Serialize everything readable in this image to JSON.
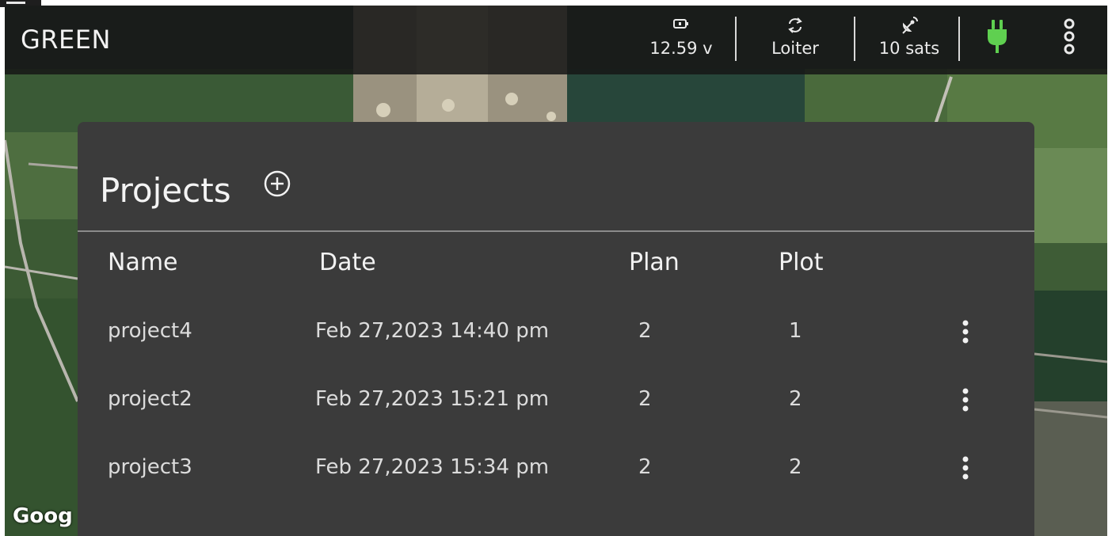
{
  "topbar": {
    "vehicle_name": "GREEN",
    "battery": {
      "icon": "battery-icon",
      "value": "12.59 v"
    },
    "mode": {
      "icon": "mode-sync-icon",
      "value": "Loiter"
    },
    "gps": {
      "icon": "satellite-icon",
      "value": "10 sats"
    },
    "connection_icon": "plug-icon",
    "connection_color": "#5fd050",
    "menu_icon": "kebab-menu-icon"
  },
  "projects_panel": {
    "title": "Projects",
    "add_icon": "add-circle-icon",
    "columns": [
      "Name",
      "Date",
      "Plan",
      "Plot"
    ],
    "rows": [
      {
        "name": "project4",
        "date": "Feb 27,2023 14:40 pm",
        "plan": "2",
        "plot": "1"
      },
      {
        "name": "project2",
        "date": "Feb 27,2023 15:21 pm",
        "plan": "2",
        "plot": "2"
      },
      {
        "name": "project3",
        "date": "Feb 27,2023 15:34 pm",
        "plan": "2",
        "plot": "2"
      }
    ],
    "row_menu_icon": "kebab-menu-icon"
  },
  "map": {
    "attribution": "Goog"
  }
}
